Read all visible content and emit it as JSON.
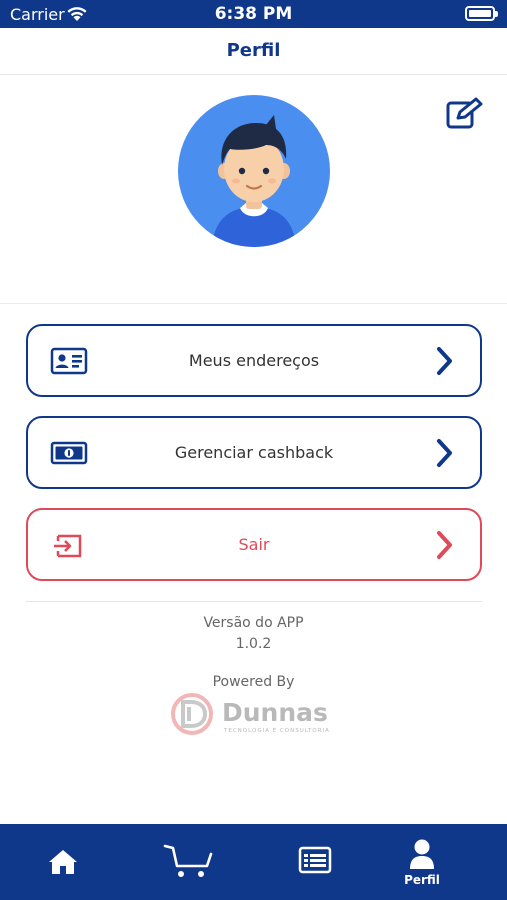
{
  "status_bar": {
    "carrier": "Carrier",
    "time": "6:38 PM",
    "battery_level": 1.0
  },
  "header": {
    "title": "Perfil"
  },
  "menu": {
    "items": [
      {
        "label": "Meus endereços",
        "icon": "id-card-icon"
      },
      {
        "label": "Gerenciar cashback",
        "icon": "money-bill-icon"
      },
      {
        "label": "Sair",
        "icon": "sign-out-icon"
      }
    ]
  },
  "footer": {
    "version_label": "Versão do APP",
    "version_value": "1.0.2",
    "powered_label": "Powered By",
    "brand_name": "Dunnas",
    "brand_tagline": "TECNOLOGIA E CONSULTORIA"
  },
  "tab_bar": {
    "tabs": [
      {
        "label": "",
        "icon": "home-icon"
      },
      {
        "label": "",
        "icon": "cart-icon"
      },
      {
        "label": "",
        "icon": "list-icon"
      },
      {
        "label": "Perfil",
        "icon": "user-icon",
        "active": true
      }
    ]
  },
  "colors": {
    "primary": "#10388a",
    "danger": "#e04a58",
    "avatar_bg": "#4a8ef0"
  }
}
